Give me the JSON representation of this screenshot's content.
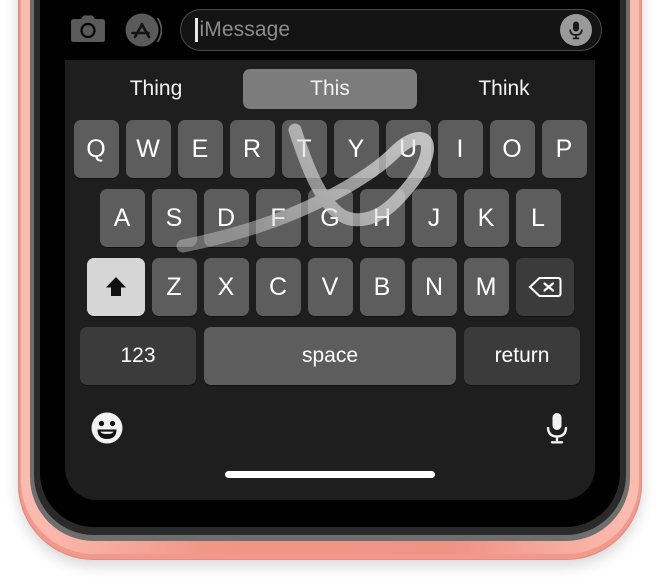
{
  "device": {
    "frame_color": "#f2998c",
    "bezel_color": "#2a2a2a",
    "screen_color": "#000000"
  },
  "top_bar": {
    "camera_icon": "camera-icon",
    "appstore_icon": "app-store-icon",
    "input": {
      "placeholder": "iMessage",
      "value": "",
      "caret_visible": true
    },
    "dictation_icon": "microphone-icon"
  },
  "keyboard": {
    "theme": "dark",
    "key_color": "#5d5d5d",
    "special_key_color": "#3b3b3b",
    "shift_active_color": "#d6d6d6",
    "background": "#1e1e1e",
    "predictions": [
      {
        "label": "Thing",
        "selected": false
      },
      {
        "label": "This",
        "selected": true
      },
      {
        "label": "Think",
        "selected": false
      }
    ],
    "rows": [
      {
        "name": "row-1",
        "keys": [
          "Q",
          "W",
          "E",
          "R",
          "T",
          "Y",
          "U",
          "I",
          "O",
          "P"
        ]
      },
      {
        "name": "row-2",
        "keys": [
          "A",
          "S",
          "D",
          "F",
          "G",
          "H",
          "J",
          "K",
          "L"
        ]
      },
      {
        "name": "row-3",
        "keys": [
          "Z",
          "X",
          "C",
          "V",
          "B",
          "N",
          "M"
        ]
      }
    ],
    "shift": {
      "label": "shift-icon",
      "active": true
    },
    "backspace": {
      "label": "backspace-icon"
    },
    "numbers_key": "123",
    "space_key": "space",
    "return_key": "return",
    "emoji_key": "emoji-icon",
    "dictation_key": "microphone-icon"
  },
  "swipe": {
    "word": "This",
    "path_keys": [
      "T",
      "H",
      "I",
      "S"
    ],
    "trail_color": "#d8d8d8",
    "trail_opacity": 0.55
  },
  "home_indicator": {
    "color": "#ffffff"
  }
}
